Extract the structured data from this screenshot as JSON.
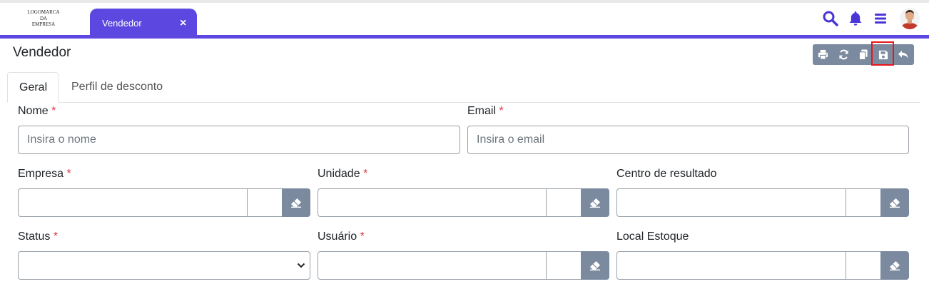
{
  "header": {
    "logo_lines": [
      "LOGOMARCA",
      "DA",
      "EMPRESA"
    ],
    "tab_label": "Vendedor",
    "tab_close": "×",
    "icons": [
      "search-icon",
      "bell-icon",
      "menu-icon",
      "avatar"
    ],
    "accent_color": "#5c48e0"
  },
  "page": {
    "title": "Vendedor",
    "toolbar": [
      "print-icon",
      "refresh-icon",
      "copy-icon",
      "save-icon",
      "undo-icon"
    ],
    "highlighted": "save-icon"
  },
  "tabs": {
    "items": [
      "Geral",
      "Perfil de desconto"
    ],
    "active": "Geral"
  },
  "form": {
    "nome": {
      "label": "Nome",
      "required": "*",
      "placeholder": "Insira o nome",
      "value": ""
    },
    "email": {
      "label": "Email",
      "required": "*",
      "placeholder": "Insira o email",
      "value": ""
    },
    "empresa": {
      "label": "Empresa",
      "required": "*",
      "value": ""
    },
    "unidade": {
      "label": "Unidade",
      "required": "*",
      "value": ""
    },
    "centro": {
      "label": "Centro de resultado",
      "value": ""
    },
    "status": {
      "label": "Status",
      "required": "*",
      "selected": ""
    },
    "usuario": {
      "label": "Usuário",
      "required": "*",
      "value": ""
    },
    "estoque": {
      "label": "Local Estoque",
      "value": ""
    }
  }
}
